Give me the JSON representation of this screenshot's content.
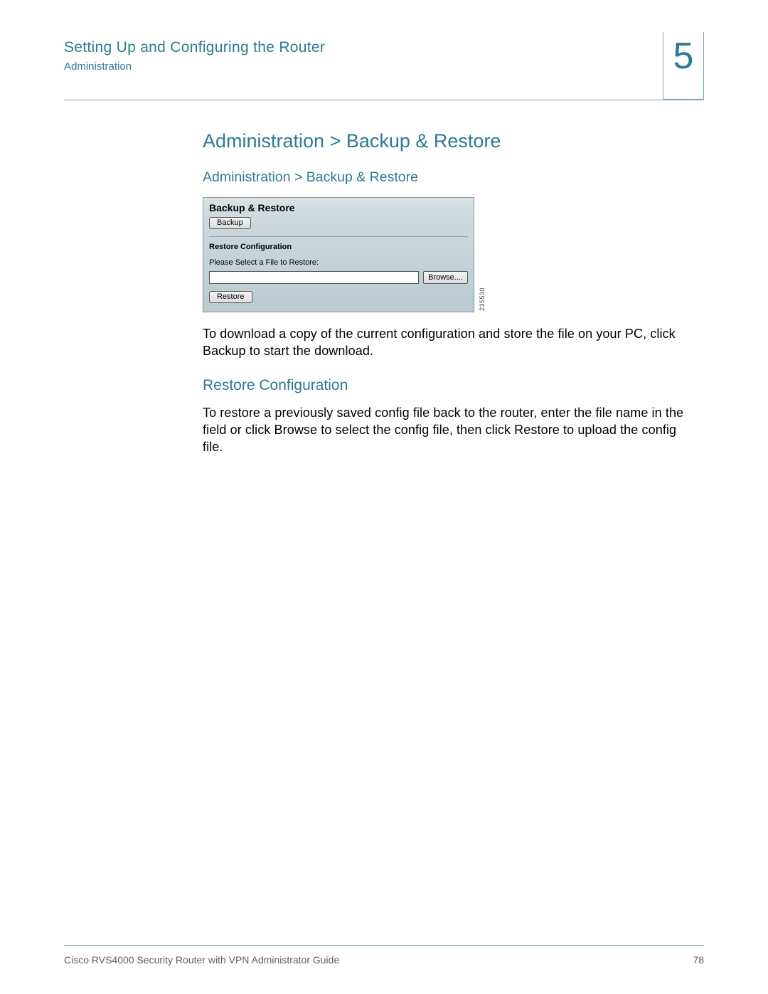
{
  "header": {
    "chapter_title": "Setting Up and Configuring the Router",
    "chapter_sub": "Administration",
    "chapter_number": "5"
  },
  "main": {
    "h1": "Administration > Backup & Restore",
    "h2": "Administration > Backup & Restore",
    "screenshot": {
      "panel_title": "Backup & Restore",
      "backup_btn": "Backup",
      "restore_heading": "Restore Configuration",
      "select_label": "Please Select a File to Restore:",
      "browse_btn": "Browse....",
      "restore_btn": "Restore",
      "side_code": "235530"
    },
    "para1": "To download a copy of the current configuration and store the file on your PC, click Backup to start the download.",
    "h3": "Restore Configuration",
    "para2": "To restore a previously saved config file back to the router, enter the file name in the field or click Browse to select the config file, then click Restore to upload the config file."
  },
  "footer": {
    "guide": "Cisco RVS4000 Security Router with VPN Administrator Guide",
    "page": "78"
  }
}
